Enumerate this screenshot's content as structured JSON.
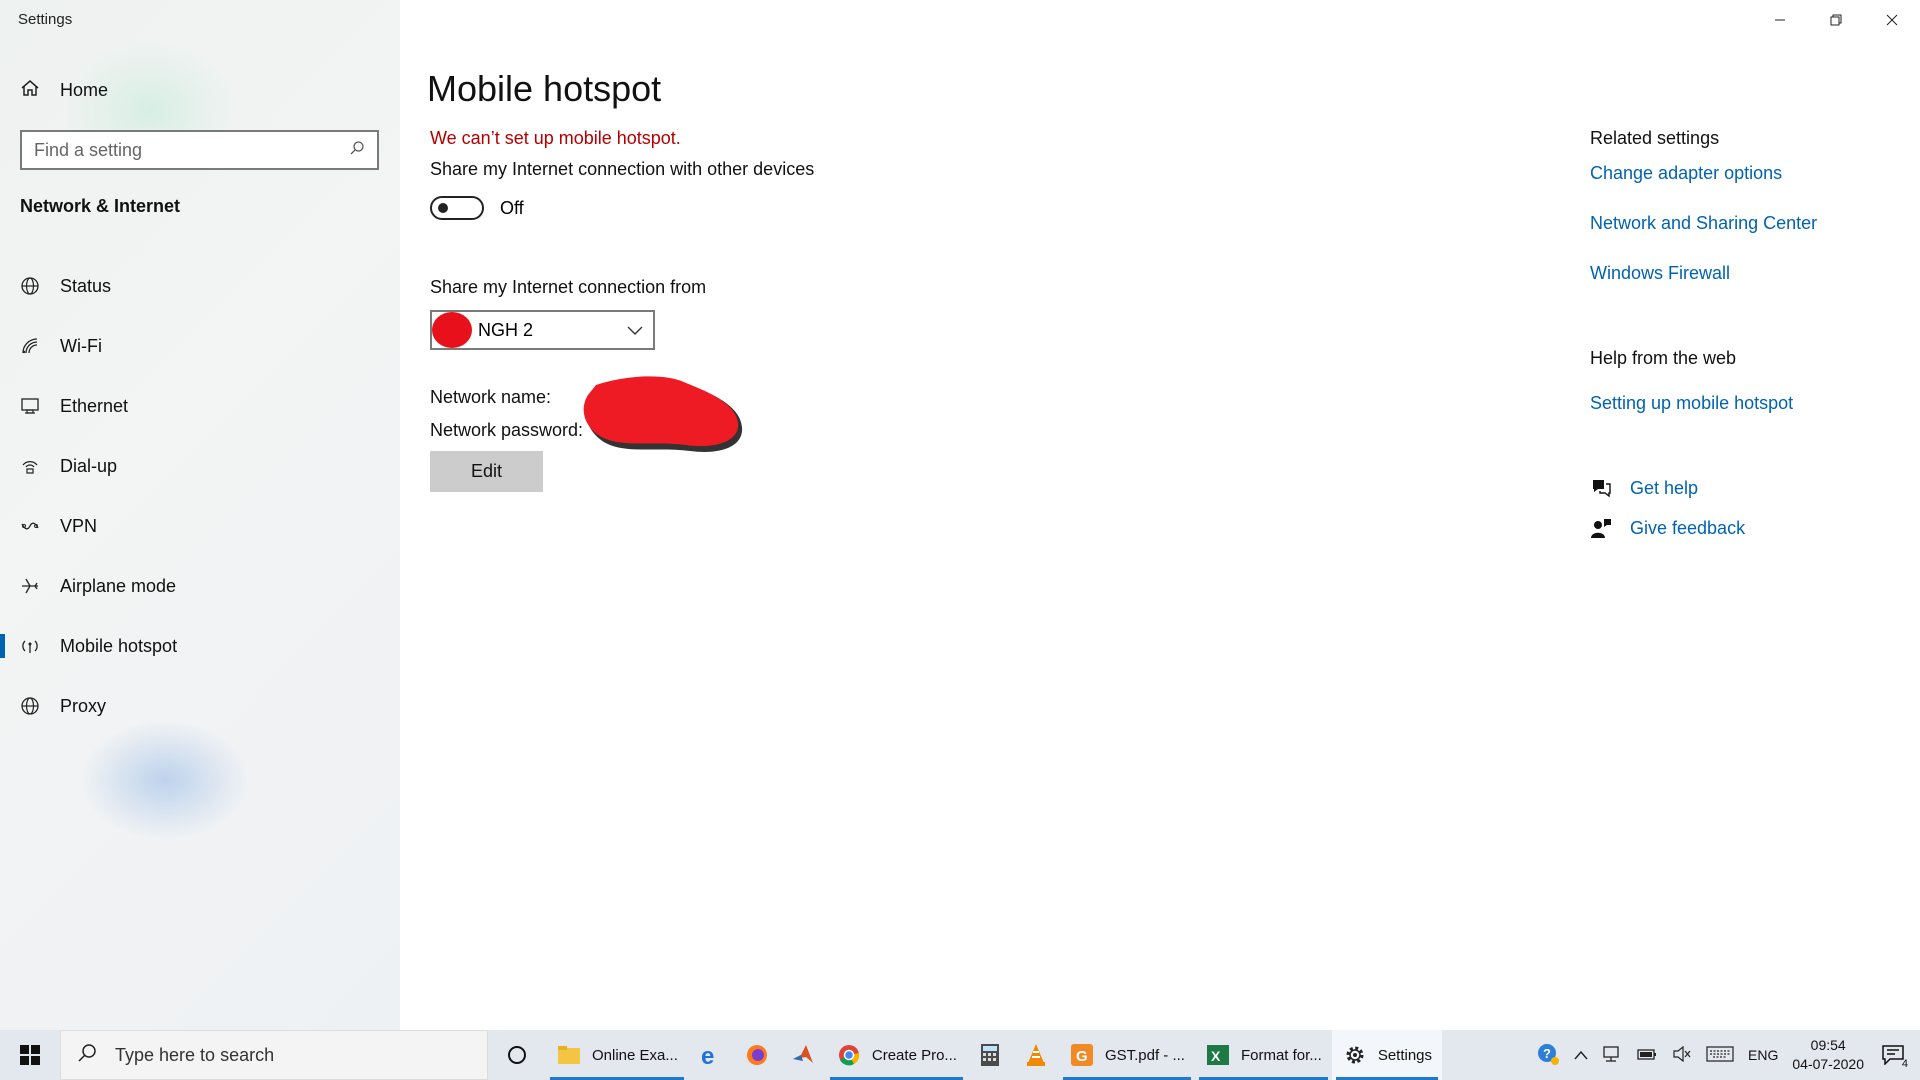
{
  "window": {
    "app_title": "Settings"
  },
  "sidebar": {
    "home_label": "Home",
    "search_placeholder": "Find a setting",
    "section_title": "Network & Internet",
    "items": [
      {
        "label": "Status",
        "icon": "globe-status-icon"
      },
      {
        "label": "Wi-Fi",
        "icon": "wifi-icon"
      },
      {
        "label": "Ethernet",
        "icon": "ethernet-icon"
      },
      {
        "label": "Dial-up",
        "icon": "dialup-icon"
      },
      {
        "label": "VPN",
        "icon": "vpn-icon"
      },
      {
        "label": "Airplane mode",
        "icon": "airplane-icon"
      },
      {
        "label": "Mobile hotspot",
        "icon": "hotspot-icon",
        "active": true
      },
      {
        "label": "Proxy",
        "icon": "globe-icon"
      }
    ]
  },
  "main": {
    "title": "Mobile hotspot",
    "error": "We can’t set up mobile hotspot.",
    "share_label": "Share my Internet connection with other devices",
    "toggle_state": "Off",
    "from_label": "Share my Internet connection from",
    "from_value": "NGH 2",
    "network_name_label": "Network name:",
    "network_password_label": "Network password:",
    "edit_label": "Edit"
  },
  "related": {
    "title": "Related settings",
    "links": [
      "Change adapter options",
      "Network and Sharing Center",
      "Windows Firewall"
    ]
  },
  "help": {
    "title": "Help from the web",
    "web_link": "Setting up mobile hotspot",
    "get_help": "Get help",
    "give_feedback": "Give feedback"
  },
  "taskbar": {
    "search_placeholder": "Type here to search",
    "apps": [
      {
        "label": "Online Exa...",
        "icon": "file-explorer-icon"
      },
      {
        "label": "",
        "icon": "edge-icon"
      },
      {
        "label": "",
        "icon": "firefox-icon"
      },
      {
        "label": "",
        "icon": "matlab-icon"
      },
      {
        "label": "Create Pro...",
        "icon": "chrome-icon"
      },
      {
        "label": "",
        "icon": "calculator-icon"
      },
      {
        "label": "",
        "icon": "vlc-icon"
      },
      {
        "label": "GST.pdf - ...",
        "icon": "pdf-reader-icon"
      },
      {
        "label": "Format for...",
        "icon": "excel-icon"
      },
      {
        "label": "Settings",
        "icon": "gear-icon"
      }
    ],
    "language": "ENG",
    "time": "09:54",
    "date": "04-07-2020",
    "notification_count": "4"
  },
  "colors": {
    "accent": "#0063b1",
    "error": "#b40000",
    "taskbar": "#e3e8ee"
  }
}
